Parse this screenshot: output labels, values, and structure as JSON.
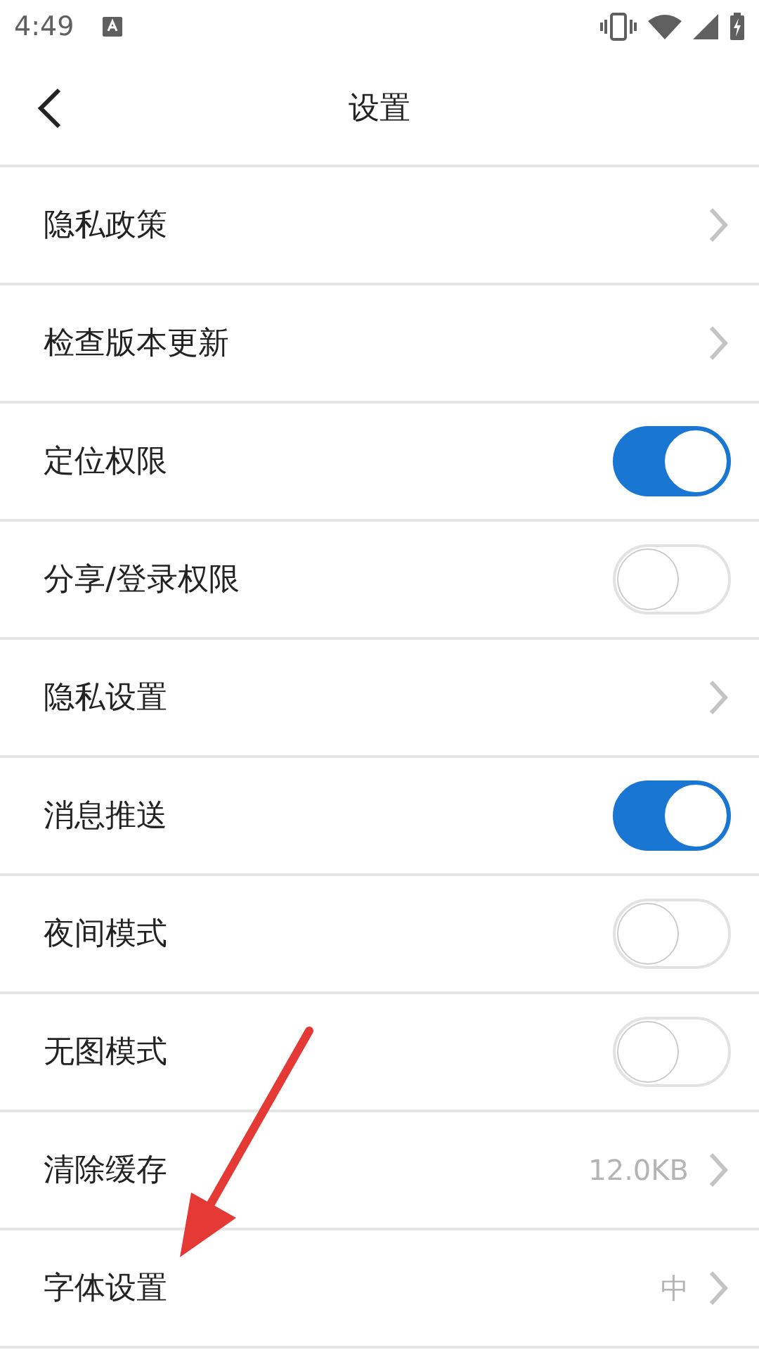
{
  "status_bar": {
    "time": "4:49"
  },
  "header": {
    "title": "设置"
  },
  "rows": [
    {
      "label": "隐私政策",
      "kind": "link"
    },
    {
      "label": "检查版本更新",
      "kind": "link"
    },
    {
      "label": "定位权限",
      "kind": "toggle",
      "on": true
    },
    {
      "label": "分享/登录权限",
      "kind": "toggle",
      "on": false
    },
    {
      "label": "隐私设置",
      "kind": "link"
    },
    {
      "label": "消息推送",
      "kind": "toggle",
      "on": true
    },
    {
      "label": "夜间模式",
      "kind": "toggle",
      "on": false
    },
    {
      "label": "无图模式",
      "kind": "toggle",
      "on": false
    },
    {
      "label": "清除缓存",
      "kind": "link",
      "value": "12.0KB"
    },
    {
      "label": "字体设置",
      "kind": "link",
      "value": "中"
    }
  ]
}
